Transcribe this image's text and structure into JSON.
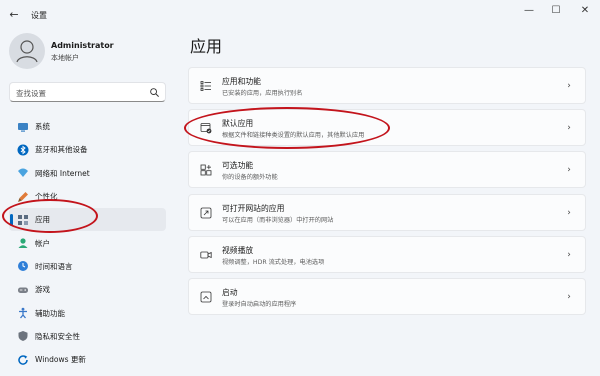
{
  "window": {
    "title": "设置",
    "back_glyph": "←",
    "min_glyph": "—",
    "max_glyph": "☐",
    "close_glyph": "✕"
  },
  "user": {
    "name": "Administrator",
    "account_type": "本地帐户"
  },
  "search": {
    "placeholder": "查找设置"
  },
  "sidebar": {
    "items": [
      {
        "label": "系统",
        "icon": "system-icon",
        "color": "#3b82c4"
      },
      {
        "label": "蓝牙和其他设备",
        "icon": "bluetooth-icon",
        "color": "#0067c0"
      },
      {
        "label": "网络和 Internet",
        "icon": "network-icon",
        "color": "#4aa3df"
      },
      {
        "label": "个性化",
        "icon": "personalization-icon",
        "color": "#e07b39"
      },
      {
        "label": "应用",
        "icon": "apps-icon",
        "color": "#5a6b80",
        "active": true
      },
      {
        "label": "帐户",
        "icon": "account-icon",
        "color": "#2aa876"
      },
      {
        "label": "时间和语言",
        "icon": "time-language-icon",
        "color": "#2f7fd8"
      },
      {
        "label": "游戏",
        "icon": "gaming-icon",
        "color": "#7a7f88"
      },
      {
        "label": "辅助功能",
        "icon": "accessibility-icon",
        "color": "#3a78c9"
      },
      {
        "label": "隐私和安全性",
        "icon": "privacy-icon",
        "color": "#6c737d"
      },
      {
        "label": "Windows 更新",
        "icon": "windows-update-icon",
        "color": "#0067c0"
      }
    ]
  },
  "main": {
    "title": "应用",
    "cards": [
      {
        "title": "应用和功能",
        "desc": "已安装的应用，应用执行别名",
        "icon": "apps-features-icon"
      },
      {
        "title": "默认应用",
        "desc": "根据文件和链接种类设置的默认应用，其他默认应用",
        "icon": "default-apps-icon"
      },
      {
        "title": "可选功能",
        "desc": "你的设备的额外功能",
        "icon": "optional-features-icon"
      },
      {
        "title": "可打开网站的应用",
        "desc": "可以在应用（而非浏览器）中打开的网站",
        "icon": "apps-for-websites-icon"
      },
      {
        "title": "视频播放",
        "desc": "视频调整，HDR 流式处理，电池选项",
        "icon": "video-playback-icon"
      },
      {
        "title": "启动",
        "desc": "登录时自动启动的应用程序",
        "icon": "startup-icon"
      }
    ],
    "chevron_glyph": "›"
  },
  "annotations": {
    "color": "#c3141c"
  }
}
